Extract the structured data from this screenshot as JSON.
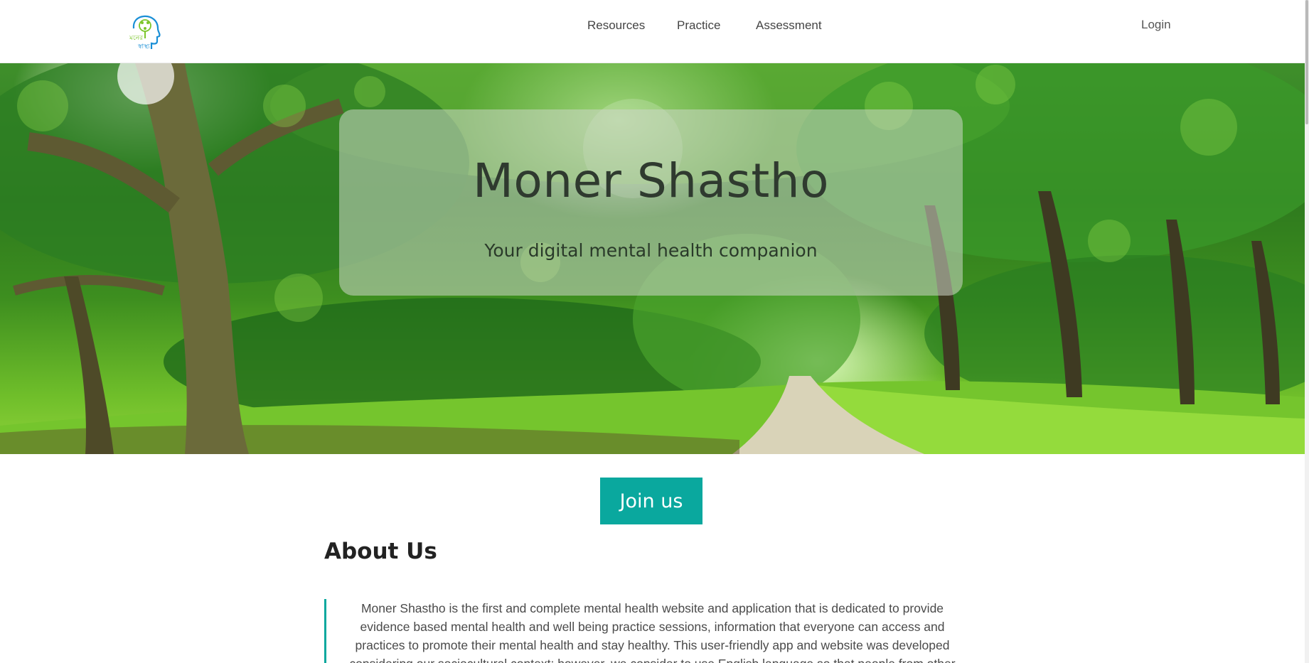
{
  "navbar": {
    "logo_alt": "Moner Shastho logo",
    "links": [
      {
        "label": "Resources"
      },
      {
        "label": "Practice"
      },
      {
        "label": "Assessment"
      }
    ],
    "login_label": "Login"
  },
  "hero": {
    "title": "Moner Shastho",
    "subtitle": "Your digital mental health companion"
  },
  "join_button_label": "Join us",
  "about": {
    "title": "About Us",
    "text": "Moner Shastho is the first and complete mental health website and application that is dedicated to provide evidence based mental health and well being practice sessions, information that everyone can access and practices to promote their mental health and stay healthy. This user-friendly app and website was developed considering our sociocultural context; however, we consider to use English language so that people from other countries can practice and use our"
  },
  "colors": {
    "accent": "#0aa89e",
    "text": "#333333",
    "nav_text": "#444444"
  }
}
